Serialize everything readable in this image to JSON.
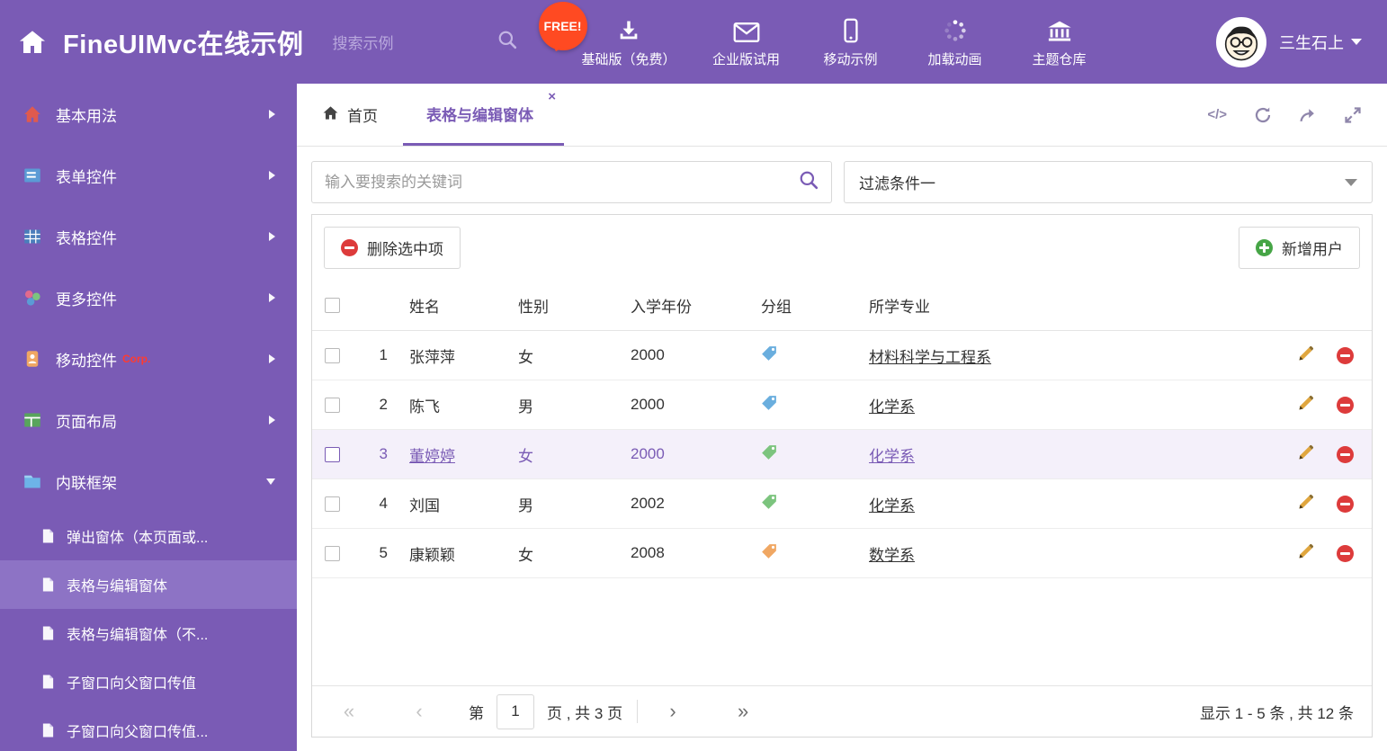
{
  "colors": {
    "purple": "#7a5bb5",
    "purple_light": "#8d73c5",
    "free_badge_bg": "#ff4a22",
    "delete_red": "#dd3b3b",
    "add_green": "#46a546",
    "pencil_yellow": "#e0a63e",
    "corp_badge": "#ff3b30",
    "selected_row_bg": "#f4f0fa"
  },
  "icons": {
    "code": "</>",
    "close_tab": "×",
    "first": "«",
    "prev": "‹",
    "next": "›",
    "last": "»"
  },
  "header": {
    "title": "FineUIMvc在线示例",
    "search_placeholder": "搜索示例",
    "free_badge": "FREE!",
    "nav": [
      {
        "label": "基础版（免费）"
      },
      {
        "label": "企业版试用"
      },
      {
        "label": "移动示例"
      },
      {
        "label": "加载动画"
      },
      {
        "label": "主题仓库"
      }
    ],
    "user_name": "三生石上"
  },
  "sidebar": {
    "items": [
      {
        "label": "基本用法"
      },
      {
        "label": "表单控件"
      },
      {
        "label": "表格控件"
      },
      {
        "label": "更多控件"
      },
      {
        "label": "移动控件",
        "badge": "Corp."
      },
      {
        "label": "页面布局"
      },
      {
        "label": "内联框架"
      }
    ],
    "subitems": [
      {
        "label": "弹出窗体（本页面或..."
      },
      {
        "label": "表格与编辑窗体"
      },
      {
        "label": "表格与编辑窗体（不..."
      },
      {
        "label": "子窗口向父窗口传值"
      },
      {
        "label": "子窗口向父窗口传值..."
      }
    ]
  },
  "tabs": {
    "home": "首页",
    "active": "表格与编辑窗体"
  },
  "filters": {
    "search_placeholder": "输入要搜索的关键词",
    "filter_value": "过滤条件一"
  },
  "toolbar": {
    "delete_label": "删除选中项",
    "add_label": "新增用户"
  },
  "table": {
    "headers": {
      "name": "姓名",
      "gender": "性别",
      "year": "入学年份",
      "group": "分组",
      "major": "所学专业"
    },
    "rows": [
      {
        "index": "1",
        "name": "张萍萍",
        "gender": "女",
        "year": "2000",
        "tag_color": "#6aaede",
        "major": "材料科学与工程系"
      },
      {
        "index": "2",
        "name": "陈飞",
        "gender": "男",
        "year": "2000",
        "tag_color": "#6aaede",
        "major": "化学系"
      },
      {
        "index": "3",
        "name": "董婷婷",
        "gender": "女",
        "year": "2000",
        "tag_color": "#7cc47e",
        "major": "化学系"
      },
      {
        "index": "4",
        "name": "刘国",
        "gender": "男",
        "year": "2002",
        "tag_color": "#7cc47e",
        "major": "化学系"
      },
      {
        "index": "5",
        "name": "康颖颖",
        "gender": "女",
        "year": "2008",
        "tag_color": "#f0a763",
        "major": "数学系"
      }
    ]
  },
  "pagination": {
    "prefix": "第",
    "page": "1",
    "suffix": "页 , 共 3 页",
    "summary": "显示 1 - 5 条 , 共 12 条"
  }
}
